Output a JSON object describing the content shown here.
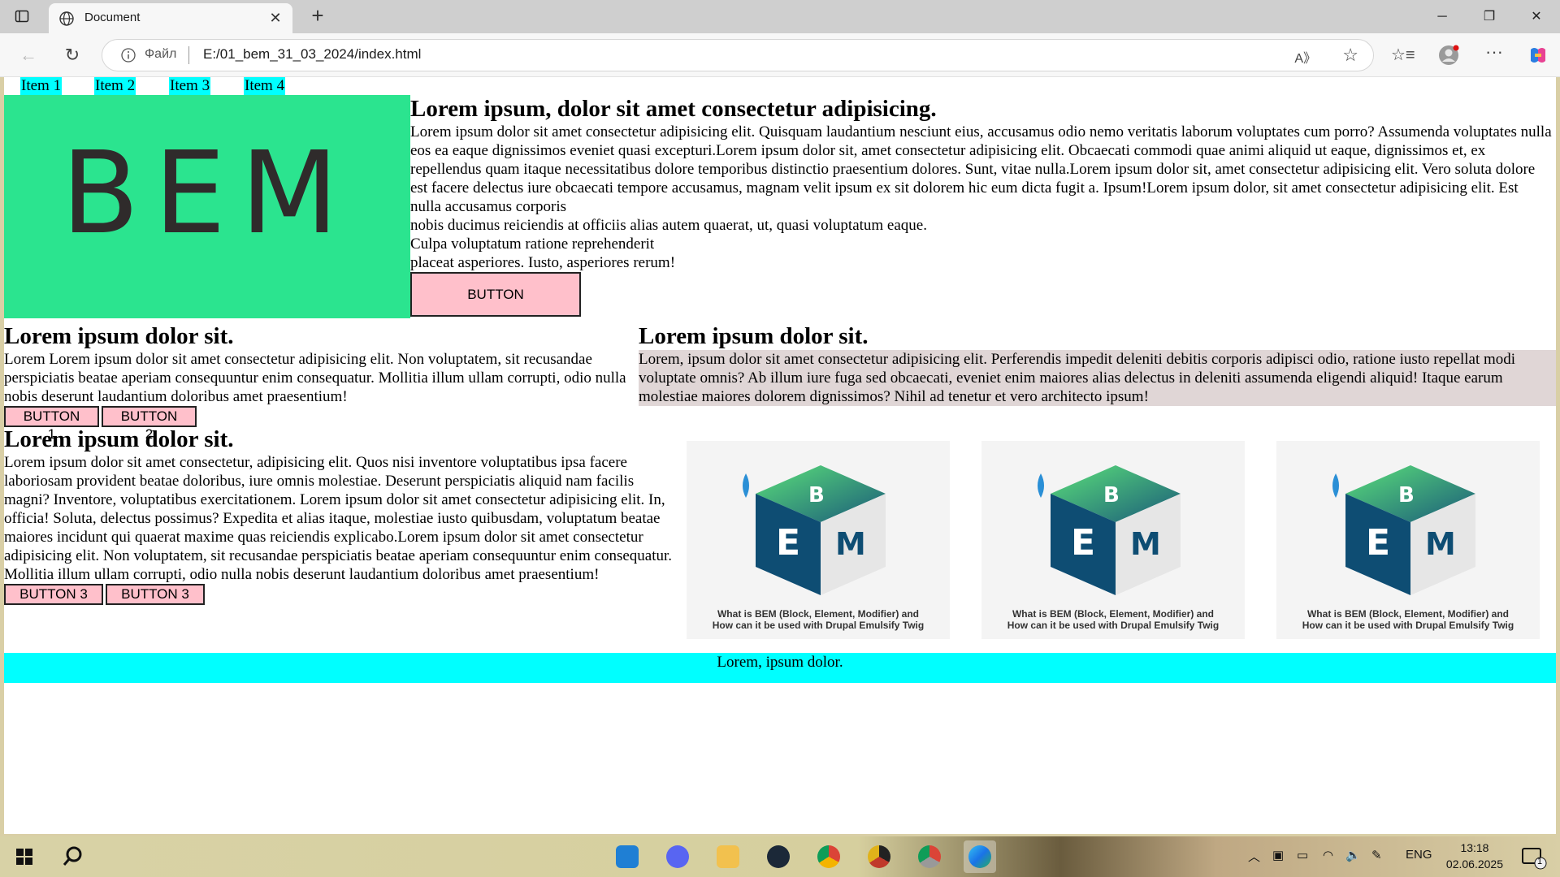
{
  "browser": {
    "tab_title": "Document",
    "site_label": "Файл",
    "url": "E:/01_bem_31_03_2024/index.html"
  },
  "page": {
    "menu": [
      "Item 1",
      "Item 2",
      "Item 3",
      "Item 4"
    ],
    "hero": {
      "logo_text": "BEM",
      "title": "Lorem ipsum, dolor sit amet consectetur adipisicing.",
      "paragraph": "Lorem ipsum dolor sit amet consectetur adipisicing elit. Quisquam laudantium nesciunt eius, accusamus odio nemo veritatis laborum voluptates cum porro? Assumenda voluptates nulla eos ea eaque dignissimos eveniet quasi excepturi.Lorem ipsum dolor sit, amet consectetur adipisicing elit. Obcaecati commodi quae animi aliquid ut eaque, dignissimos et, ex repellendus quam itaque necessitatibus dolore temporibus distinctio praesentium dolores. Sunt, vitae nulla.Lorem ipsum dolor sit, amet consectetur adipisicing elit. Vero soluta dolore est facere delectus iure obcaecati tempore accusamus, magnam velit ipsum ex sit dolorem hic eum dicta fugit a. Ipsum!Lorem ipsum dolor, sit amet consectetur adipisicing elit. Est nulla accusamus corporis",
      "line2": "nobis ducimus reiciendis at officiis alias autem quaerat, ut, quasi voluptatum eaque.",
      "line3": "Culpa voluptatum ratione reprehenderit",
      "line4": "placeat asperiores. Iusto, asperiores rerum!",
      "button": "BUTTON"
    },
    "left_block": {
      "title": "Lorem ipsum dolor sit.",
      "paragraph": "Lorem Lorem ipsum dolor sit amet consectetur adipisicing elit. Non voluptatem, sit recusandae perspiciatis beatae aperiam consequuntur enim consequatur. Mollitia illum ullam corrupti, odio nulla nobis deserunt laudantium doloribus amet praesentium!",
      "button1": "BUTTON 1",
      "button2": "BUTTON 2"
    },
    "right_block": {
      "title": "Lorem ipsum dolor sit.",
      "paragraph": "Lorem, ipsum dolor sit amet consectetur adipisicing elit. Perferendis impedit deleniti debitis corporis adipisci odio, ratione iusto repellat modi voluptate omnis? Ab illum iure fuga sed obcaecati, eveniet enim maiores alias delectus in deleniti assumenda eligendi aliquid! Itaque earum molestiae maiores dolorem dignissimos? Nihil ad tenetur et vero architecto ipsum!"
    },
    "second_block": {
      "title": "Lorem ipsum dolor sit.",
      "paragraph": "Lorem ipsum dolor sit amet consectetur, adipisicing elit. Quos nisi inventore voluptatibus ipsa facere laboriosam provident beatae doloribus, iure omnis molestiae. Deserunt perspiciatis aliquid nam facilis magni? Inventore, voluptatibus exercitationem. Lorem ipsum dolor sit amet consectetur adipisicing elit. In, officia! Soluta, delectus possimus? Expedita et alias itaque, molestiae iusto quibusdam, voluptatum beatae maiores incidunt qui quaerat maxime quas reiciendis explicabo.Lorem ipsum dolor sit amet consectetur adipisicing elit. Non voluptatem, sit recusandae perspiciatis beatae aperiam consequuntur enim consequatur.",
      "line2": "Mollitia illum ullam corrupti, odio nulla nobis deserunt laudantium doloribus amet praesentium!",
      "button1": "BUTTON 3",
      "button2": "BUTTON 3"
    },
    "cards": [
      {
        "caption1": "What is BEM (Block, Element, Modifier) and",
        "caption2": "How can it be used with Drupal Emulsify Twig"
      },
      {
        "caption1": "What is BEM (Block, Element, Modifier) and",
        "caption2": "How can it be used with Drupal Emulsify Twig"
      },
      {
        "caption1": "What is BEM (Block, Element, Modifier) and",
        "caption2": "How can it be used with Drupal Emulsify Twig"
      }
    ],
    "footer": "Lorem, ipsum dolor."
  },
  "taskbar": {
    "language": "ENG",
    "time": "13:18",
    "date": "02.06.2025",
    "notification_count": "1"
  },
  "colors": {
    "menu_bg": "#00ffff",
    "hero_bg": "#2be48f",
    "button_bg": "#ffc0cb",
    "right_para_bg": "#e0d6d6",
    "footer_bg": "#00ffff"
  }
}
